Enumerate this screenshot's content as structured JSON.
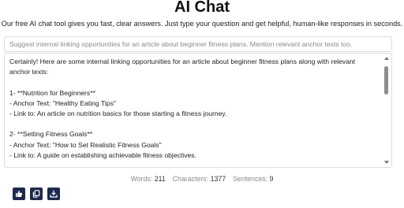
{
  "header": {
    "title": "AI Chat",
    "subtitle": "Our free AI chat tool gives you fast, clear answers. Just type your question and get helpful, human-like responses in seconds."
  },
  "prompt": {
    "placeholder": "Suggest internal linking opportunities for an article about beginner fitness plans. Mention relevant anchor texts too."
  },
  "response": {
    "lines": [
      "Certainly! Here are some internal linking opportunities for an article about beginner fitness plans along with relevant",
      "anchor texts:",
      "",
      "1- **Nutrition for Beginners**",
      "- Anchor Text: \"Healthy Eating Tips\"",
      "- Link to: An article on nutrition basics for those starting a fitness journey.",
      "",
      "2- **Setting Fitness Goals**",
      "- Anchor Text: \"How to Set Realistic Fitness Goals\"",
      "- Link to: A guide on establishing achievable fitness objectives.",
      ""
    ]
  },
  "stats": {
    "words_label": "Words:",
    "words_value": "211",
    "characters_label": "Characters:",
    "characters_value": "1377",
    "sentences_label": "Sentences:",
    "sentences_value": "9"
  },
  "actions": {
    "like_icon": "thumbs-up-icon",
    "copy_icon": "copy-icon",
    "download_icon": "download-icon"
  },
  "colors": {
    "button_bg": "#1d2a4d",
    "muted_text": "#8a8a8a",
    "border": "#dcdcdc"
  }
}
